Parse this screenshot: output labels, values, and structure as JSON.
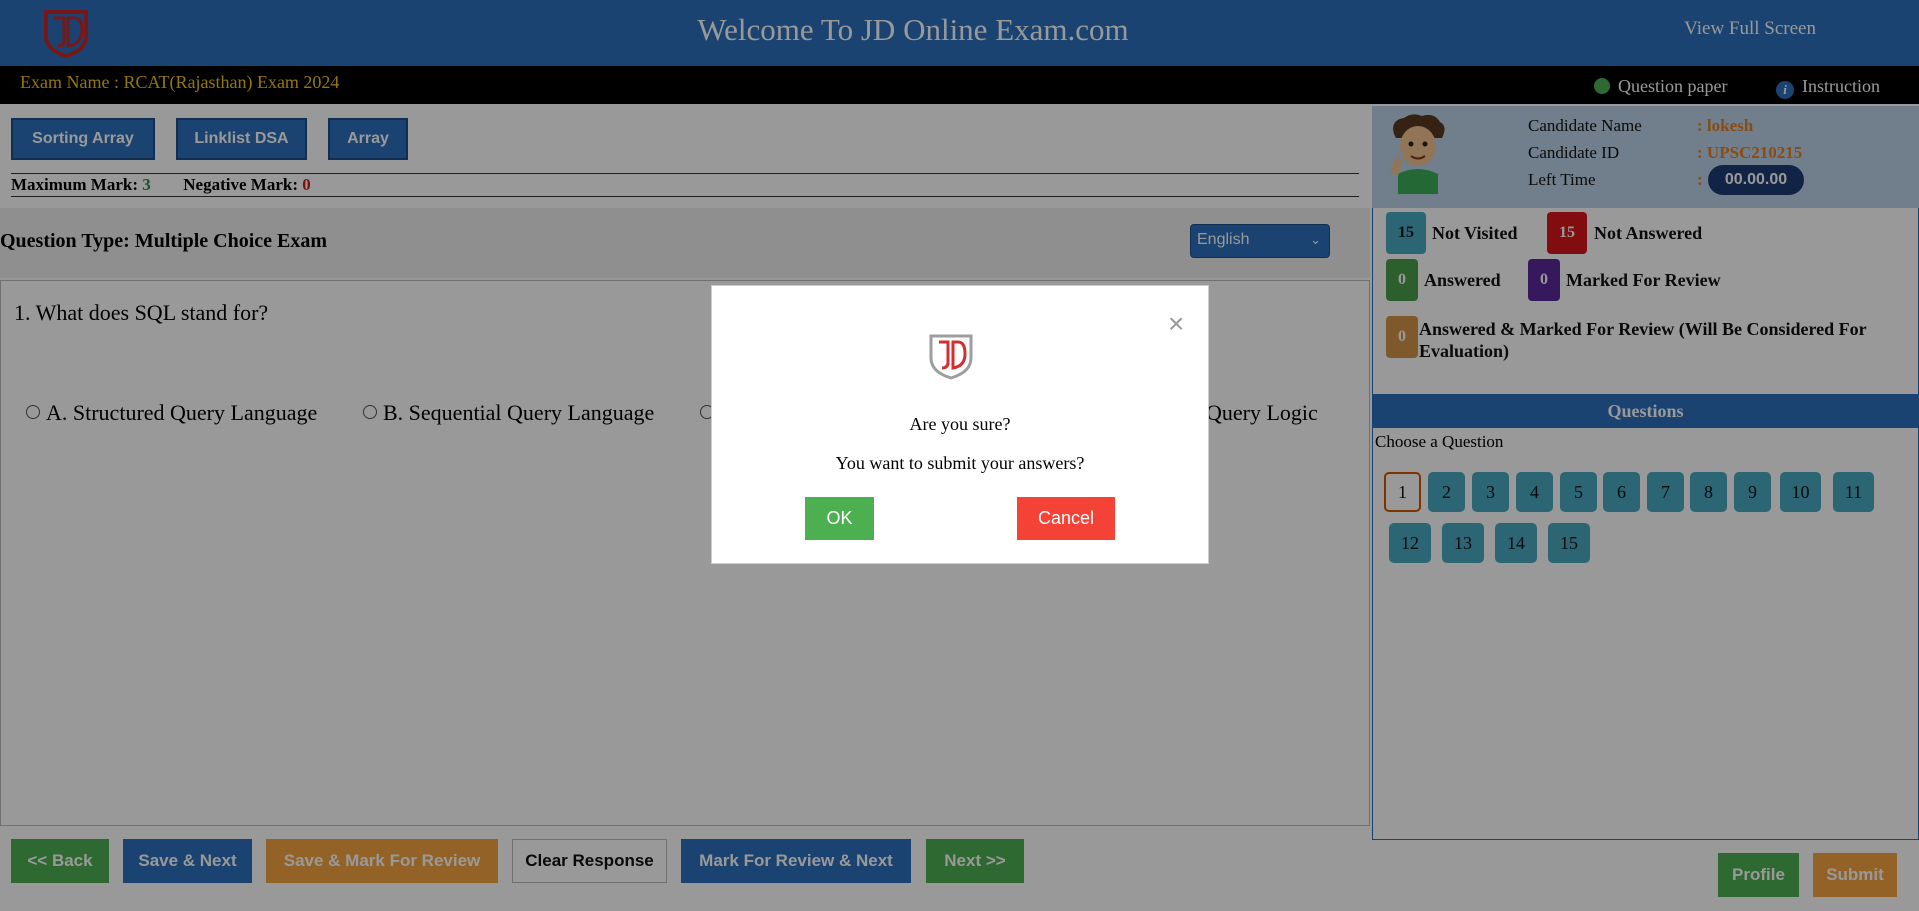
{
  "header": {
    "title": "Welcome To JD Online Exam.com",
    "fullscreen_label": "View Full Screen"
  },
  "exam": {
    "name": "Exam Name : RCAT(Rajasthan) Exam 2024",
    "question_paper_label": "Question paper",
    "instruction_label": "Instruction"
  },
  "sections": [
    {
      "label": "Sorting Array"
    },
    {
      "label": "Linklist DSA"
    },
    {
      "label": "Array"
    }
  ],
  "marks": {
    "max_label": "Maximum Mark:",
    "max_value": "3",
    "neg_label": "Negative Mark:",
    "neg_value": "0"
  },
  "question": {
    "type_label": "Question Type: Multiple Choice Exam",
    "language": "English",
    "text": "1. What does SQL stand for?",
    "options": [
      "A. Structured Query Language",
      "B. Sequential Query Language",
      "Query Logic"
    ]
  },
  "candidate": {
    "name_label": "Candidate Name",
    "name_value": ": lokesh",
    "id_label": "Candidate ID",
    "id_value": ": UPSC210215",
    "time_label": "Left Time",
    "time_colon": ":",
    "time_value": "00.00.00"
  },
  "legend": [
    {
      "count": "15",
      "label": "Not Visited",
      "color": "#4aa8c0"
    },
    {
      "count": "15",
      "label": "Not Answered",
      "color": "#d9171c"
    },
    {
      "count": "0",
      "label": "Answered",
      "color": "#4a9e4a"
    },
    {
      "count": "0",
      "label": "Marked For Review",
      "color": "#5b2a9b"
    },
    {
      "count": "0",
      "label": "Answered & Marked For Review (Will Be Considered For Evaluation)",
      "color": "#d4954a"
    }
  ],
  "questions_panel": {
    "title": "Questions",
    "choose_label": "Choose a Question",
    "numbers": [
      "1",
      "2",
      "3",
      "4",
      "5",
      "6",
      "7",
      "8",
      "9",
      "10",
      "11",
      "12",
      "13",
      "14",
      "15"
    ]
  },
  "buttons": {
    "back": "<< Back",
    "save_next": "Save & Next",
    "save_mark": "Save & Mark For Review",
    "clear": "Clear Response",
    "mark_next": "Mark For Review & Next",
    "next": "Next >>",
    "profile": "Profile",
    "submit": "Submit"
  },
  "modal": {
    "title": "Are you sure?",
    "text": "You want to submit your answers?",
    "ok": "OK",
    "cancel": "Cancel",
    "close": "×"
  }
}
